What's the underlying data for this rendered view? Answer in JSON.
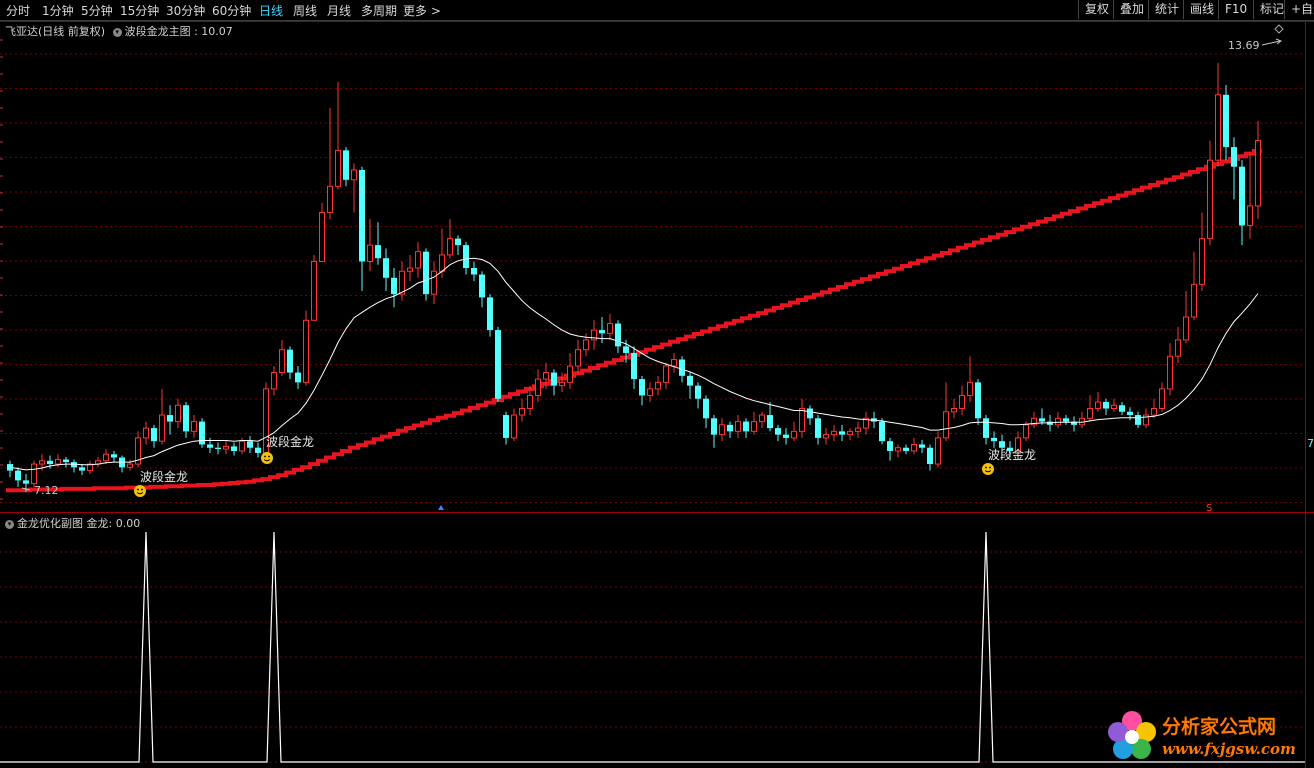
{
  "toolbar": {
    "periods": [
      "分时",
      "1分钟",
      "5分钟",
      "15分钟",
      "30分钟",
      "60分钟",
      "日线",
      "周线",
      "月线",
      "多周期",
      "更多 >"
    ],
    "active_period": "日线",
    "tools": [
      "复权",
      "叠加",
      "统计",
      "画线",
      "F10",
      "标记",
      "+自选"
    ]
  },
  "main_panel": {
    "stock_title": "飞亚达(日线 前复权)",
    "indicator_name": "波段金龙主图",
    "indicator_value": ": 10.07",
    "high_marker": "13.69",
    "low_marker": "7.12",
    "signal_label": "波段金龙",
    "right_edge_label": "7"
  },
  "sub_panel": {
    "indicator_name": "金龙优化副图",
    "series_label": "金龙:",
    "series_value": "0.00"
  },
  "watermark": {
    "title": "分析家公式网",
    "url": "www.fxjgsw.com"
  },
  "chart_data": {
    "type": "candlestick",
    "price_range": [
      7.0,
      14.1
    ],
    "price_high": 13.69,
    "price_low": 7.12,
    "colors": {
      "up": "#ff3333",
      "down": "#54ffff",
      "ma": "#ffffff",
      "band": "#e8141e",
      "grid": "#7a0000"
    },
    "candles": [
      [
        7.55,
        7.45,
        7.6,
        7.35
      ],
      [
        7.45,
        7.3,
        7.5,
        7.2
      ],
      [
        7.3,
        7.25,
        7.4,
        7.12
      ],
      [
        7.25,
        7.55,
        7.6,
        7.2
      ],
      [
        7.55,
        7.6,
        7.7,
        7.45
      ],
      [
        7.6,
        7.55,
        7.68,
        7.48
      ],
      [
        7.55,
        7.62,
        7.7,
        7.5
      ],
      [
        7.62,
        7.58,
        7.66,
        7.5
      ],
      [
        7.58,
        7.5,
        7.62,
        7.42
      ],
      [
        7.5,
        7.45,
        7.55,
        7.38
      ],
      [
        7.45,
        7.55,
        7.6,
        7.4
      ],
      [
        7.55,
        7.6,
        7.66,
        7.5
      ],
      [
        7.6,
        7.7,
        7.78,
        7.55
      ],
      [
        7.7,
        7.65,
        7.75,
        7.58
      ],
      [
        7.65,
        7.5,
        7.68,
        7.42
      ],
      [
        7.5,
        7.55,
        7.62,
        7.45
      ],
      [
        7.55,
        7.95,
        8.05,
        7.5
      ],
      [
        7.95,
        8.1,
        8.2,
        7.85
      ],
      [
        8.1,
        7.9,
        8.15,
        7.8
      ],
      [
        7.9,
        8.3,
        8.7,
        7.85
      ],
      [
        8.3,
        8.2,
        8.45,
        8.0
      ],
      [
        8.2,
        8.45,
        8.55,
        8.1
      ],
      [
        8.45,
        8.05,
        8.5,
        7.95
      ],
      [
        8.05,
        8.2,
        8.3,
        7.95
      ],
      [
        8.2,
        7.85,
        8.25,
        7.8
      ],
      [
        7.85,
        7.8,
        7.95,
        7.72
      ],
      [
        7.8,
        7.78,
        7.88,
        7.7
      ],
      [
        7.78,
        7.82,
        7.9,
        7.7
      ],
      [
        7.82,
        7.75,
        7.88,
        7.68
      ],
      [
        7.75,
        7.9,
        7.95,
        7.7
      ],
      [
        7.9,
        7.8,
        7.98,
        7.72
      ],
      [
        7.8,
        7.72,
        7.88,
        7.65
      ],
      [
        7.72,
        8.7,
        8.8,
        7.68
      ],
      [
        8.7,
        8.95,
        9.05,
        8.6
      ],
      [
        8.95,
        9.3,
        9.45,
        8.9
      ],
      [
        9.3,
        8.95,
        9.35,
        8.85
      ],
      [
        8.95,
        8.8,
        9.05,
        8.7
      ],
      [
        8.8,
        9.75,
        9.9,
        8.75
      ],
      [
        9.75,
        10.65,
        10.75,
        10.55
      ],
      [
        10.65,
        11.4,
        11.55,
        11.2
      ],
      [
        11.4,
        11.8,
        13.0,
        11.3
      ],
      [
        11.8,
        12.35,
        13.4,
        11.75
      ],
      [
        12.35,
        11.9,
        12.4,
        11.8
      ],
      [
        11.9,
        12.05,
        12.15,
        11.4
      ],
      [
        12.05,
        10.65,
        12.1,
        10.2
      ],
      [
        10.65,
        10.9,
        11.3,
        10.5
      ],
      [
        10.9,
        10.7,
        11.25,
        10.6
      ],
      [
        10.7,
        10.4,
        10.85,
        10.2
      ],
      [
        10.4,
        10.15,
        10.55,
        9.95
      ],
      [
        10.15,
        10.5,
        10.65,
        10.05
      ],
      [
        10.5,
        10.55,
        10.75,
        10.35
      ],
      [
        10.55,
        10.8,
        10.95,
        10.4
      ],
      [
        10.8,
        10.15,
        10.85,
        10.05
      ],
      [
        10.15,
        10.5,
        10.65,
        10.0
      ],
      [
        10.5,
        10.75,
        11.15,
        10.4
      ],
      [
        10.75,
        11.0,
        11.3,
        10.7
      ],
      [
        11.0,
        10.9,
        11.05,
        10.75
      ],
      [
        10.9,
        10.55,
        10.95,
        10.45
      ],
      [
        10.55,
        10.45,
        10.65,
        10.35
      ],
      [
        10.45,
        10.1,
        10.5,
        9.95
      ],
      [
        10.1,
        9.6,
        10.15,
        9.5
      ],
      [
        9.6,
        8.55,
        9.65,
        8.5
      ],
      [
        8.3,
        7.95,
        8.35,
        7.85
      ],
      [
        7.95,
        8.3,
        8.4,
        7.9
      ],
      [
        8.3,
        8.4,
        8.55,
        8.2
      ],
      [
        8.4,
        8.6,
        8.75,
        8.3
      ],
      [
        8.6,
        8.85,
        9.0,
        8.5
      ],
      [
        8.85,
        8.95,
        9.1,
        8.7
      ],
      [
        8.95,
        8.75,
        9.0,
        8.6
      ],
      [
        8.75,
        8.8,
        8.95,
        8.65
      ],
      [
        8.8,
        9.05,
        9.25,
        8.7
      ],
      [
        9.05,
        9.3,
        9.45,
        8.95
      ],
      [
        9.3,
        9.45,
        9.55,
        9.2
      ],
      [
        9.45,
        9.6,
        9.75,
        9.3
      ],
      [
        9.6,
        9.55,
        9.8,
        9.4
      ],
      [
        9.55,
        9.7,
        9.85,
        9.45
      ],
      [
        9.7,
        9.35,
        9.75,
        9.25
      ],
      [
        9.35,
        9.25,
        9.45,
        9.1
      ],
      [
        9.25,
        8.85,
        9.35,
        8.7
      ],
      [
        8.85,
        8.6,
        8.9,
        8.45
      ],
      [
        8.6,
        8.7,
        8.8,
        8.5
      ],
      [
        8.7,
        8.8,
        8.9,
        8.6
      ],
      [
        8.8,
        9.05,
        9.1,
        8.7
      ],
      [
        9.05,
        9.15,
        9.25,
        8.95
      ],
      [
        9.15,
        8.9,
        9.2,
        8.8
      ],
      [
        8.9,
        8.75,
        8.95,
        8.55
      ],
      [
        8.75,
        8.55,
        8.8,
        8.4
      ],
      [
        8.55,
        8.25,
        8.6,
        8.1
      ],
      [
        8.25,
        8.0,
        8.3,
        7.8
      ],
      [
        8.0,
        8.15,
        8.25,
        7.9
      ],
      [
        8.15,
        8.05,
        8.2,
        7.95
      ],
      [
        8.05,
        8.2,
        8.3,
        7.95
      ],
      [
        8.2,
        8.05,
        8.25,
        7.95
      ],
      [
        8.05,
        8.2,
        8.35,
        8.0
      ],
      [
        8.2,
        8.3,
        8.35,
        8.1
      ],
      [
        8.3,
        8.1,
        8.5,
        8.05
      ],
      [
        8.1,
        8.0,
        8.15,
        7.9
      ],
      [
        8.0,
        7.95,
        8.1,
        7.85
      ],
      [
        7.95,
        8.05,
        8.2,
        7.9
      ],
      [
        8.05,
        8.4,
        8.55,
        7.95
      ],
      [
        8.4,
        8.25,
        8.45,
        8.15
      ],
      [
        8.25,
        7.95,
        8.3,
        7.85
      ],
      [
        7.95,
        8.0,
        8.1,
        7.85
      ],
      [
        8.0,
        8.05,
        8.15,
        7.9
      ],
      [
        8.05,
        8.0,
        8.15,
        7.9
      ],
      [
        8.0,
        8.05,
        8.1,
        7.92
      ],
      [
        8.05,
        8.1,
        8.2,
        7.95
      ],
      [
        8.1,
        8.25,
        8.35,
        8.0
      ],
      [
        8.25,
        8.2,
        8.35,
        8.1
      ],
      [
        8.2,
        7.9,
        8.25,
        7.85
      ],
      [
        7.9,
        7.75,
        7.95,
        7.6
      ],
      [
        7.75,
        7.8,
        7.85,
        7.65
      ],
      [
        7.8,
        7.75,
        7.85,
        7.7
      ],
      [
        7.75,
        7.85,
        7.95,
        7.7
      ],
      [
        7.85,
        7.8,
        7.92,
        7.72
      ],
      [
        7.8,
        7.55,
        7.85,
        7.45
      ],
      [
        7.55,
        7.95,
        8.05,
        7.5
      ],
      [
        7.95,
        8.35,
        8.8,
        7.9
      ],
      [
        8.35,
        8.4,
        8.55,
        8.25
      ],
      [
        8.4,
        8.6,
        8.75,
        8.3
      ],
      [
        8.6,
        8.8,
        9.2,
        8.5
      ],
      [
        8.8,
        8.25,
        8.85,
        8.15
      ],
      [
        8.25,
        7.95,
        8.3,
        7.85
      ],
      [
        7.95,
        7.9,
        8.05,
        7.8
      ],
      [
        7.9,
        7.8,
        8.0,
        7.75
      ],
      [
        7.8,
        7.75,
        7.9,
        7.65
      ],
      [
        7.75,
        7.95,
        8.05,
        7.7
      ],
      [
        7.95,
        8.15,
        8.2,
        7.9
      ],
      [
        8.15,
        8.25,
        8.35,
        8.1
      ],
      [
        8.25,
        8.2,
        8.4,
        8.15
      ],
      [
        8.2,
        8.15,
        8.3,
        8.05
      ],
      [
        8.15,
        8.25,
        8.35,
        8.1
      ],
      [
        8.25,
        8.2,
        8.3,
        8.15
      ],
      [
        8.2,
        8.15,
        8.28,
        8.05
      ],
      [
        8.15,
        8.25,
        8.35,
        8.1
      ],
      [
        8.25,
        8.4,
        8.6,
        8.2
      ],
      [
        8.4,
        8.5,
        8.65,
        8.35
      ],
      [
        8.5,
        8.4,
        8.55,
        8.3
      ],
      [
        8.4,
        8.45,
        8.55,
        8.35
      ],
      [
        8.45,
        8.35,
        8.5,
        8.3
      ],
      [
        8.35,
        8.3,
        8.42,
        8.22
      ],
      [
        8.3,
        8.15,
        8.35,
        8.1
      ],
      [
        8.15,
        8.3,
        8.4,
        8.1
      ],
      [
        8.3,
        8.4,
        8.55,
        8.25
      ],
      [
        8.4,
        8.7,
        8.8,
        8.35
      ],
      [
        8.7,
        9.2,
        9.4,
        8.6
      ],
      [
        9.2,
        9.45,
        9.65,
        9.1
      ],
      [
        9.45,
        9.8,
        10.2,
        9.4
      ],
      [
        9.8,
        10.3,
        10.8,
        9.75
      ],
      [
        10.3,
        11.0,
        11.4,
        10.2
      ],
      [
        11.0,
        12.2,
        12.5,
        10.9
      ],
      [
        12.2,
        13.2,
        13.69,
        12.1
      ],
      [
        13.2,
        12.4,
        13.35,
        12.2
      ],
      [
        12.4,
        12.1,
        12.55,
        11.6
      ],
      [
        12.1,
        11.2,
        12.2,
        10.9
      ],
      [
        11.2,
        11.5,
        12.3,
        11.0
      ],
      [
        11.5,
        12.5,
        12.8,
        11.3
      ]
    ],
    "ma_line": [
      7.5,
      7.48,
      7.46,
      7.47,
      7.49,
      7.52,
      7.54,
      7.55,
      7.55,
      7.54,
      7.54,
      7.55,
      7.57,
      7.58,
      7.58,
      7.58,
      7.61,
      7.65,
      7.68,
      7.74,
      7.79,
      7.84,
      7.87,
      7.9,
      7.91,
      7.91,
      7.91,
      7.91,
      7.9,
      7.91,
      7.91,
      7.9,
      7.96,
      8.03,
      8.14,
      8.24,
      8.33,
      8.48,
      8.68,
      8.91,
      9.15,
      9.41,
      9.62,
      9.79,
      9.87,
      9.95,
      10.02,
      10.08,
      10.12,
      10.18,
      10.24,
      10.32,
      10.36,
      10.41,
      10.5,
      10.6,
      10.66,
      10.69,
      10.7,
      10.68,
      10.62,
      10.5,
      10.33,
      10.19,
      10.05,
      9.94,
      9.85,
      9.77,
      9.68,
      9.6,
      9.54,
      9.51,
      9.49,
      9.48,
      9.47,
      9.47,
      9.43,
      9.39,
      9.32,
      9.24,
      9.17,
      9.12,
      9.08,
      9.04,
      9.0,
      8.96,
      8.91,
      8.85,
      8.78,
      8.72,
      8.66,
      8.61,
      8.56,
      8.52,
      8.49,
      8.46,
      8.43,
      8.4,
      8.37,
      8.37,
      8.35,
      8.33,
      8.31,
      8.29,
      8.27,
      8.26,
      8.24,
      8.23,
      8.22,
      8.21,
      8.19,
      8.17,
      8.15,
      8.13,
      8.11,
      8.07,
      8.07,
      8.09,
      8.11,
      8.14,
      8.18,
      8.19,
      8.19,
      8.18,
      8.17,
      8.15,
      8.15,
      8.16,
      8.17,
      8.18,
      8.18,
      8.19,
      8.19,
      8.19,
      8.19,
      8.21,
      8.23,
      8.24,
      8.25,
      8.26,
      8.26,
      8.26,
      8.27,
      8.28,
      8.31,
      8.37,
      8.45,
      8.56,
      8.69,
      8.85,
      9.07,
      9.33,
      9.55,
      9.73,
      9.86,
      10.0,
      10.16
    ],
    "band_line": [
      7.15,
      7.15,
      7.15,
      7.16,
      7.16,
      7.16,
      7.16,
      7.17,
      7.17,
      7.17,
      7.17,
      7.18,
      7.18,
      7.18,
      7.18,
      7.19,
      7.19,
      7.19,
      7.2,
      7.2,
      7.21,
      7.21,
      7.22,
      7.22,
      7.23,
      7.23,
      7.24,
      7.25,
      7.26,
      7.27,
      7.28,
      7.3,
      7.32,
      7.35,
      7.38,
      7.42,
      7.46,
      7.5,
      7.55,
      7.6,
      7.65,
      7.7,
      7.75,
      7.8,
      7.84,
      7.88,
      7.93,
      7.97,
      8.01,
      8.06,
      8.1,
      8.14,
      8.18,
      8.22,
      8.26,
      8.29,
      8.33,
      8.37,
      8.41,
      8.45,
      8.49,
      8.53,
      8.58,
      8.62,
      8.66,
      8.7,
      8.74,
      8.78,
      8.82,
      8.86,
      8.9,
      8.94,
      8.98,
      9.02,
      9.06,
      9.1,
      9.14,
      9.18,
      9.22,
      9.26,
      9.3,
      9.34,
      9.38,
      9.42,
      9.46,
      9.5,
      9.54,
      9.58,
      9.62,
      9.66,
      9.7,
      9.74,
      9.78,
      9.82,
      9.86,
      9.9,
      9.94,
      9.98,
      10.02,
      10.06,
      10.1,
      10.14,
      10.18,
      10.22,
      10.26,
      10.3,
      10.34,
      10.38,
      10.42,
      10.46,
      10.5,
      10.54,
      10.58,
      10.62,
      10.66,
      10.7,
      10.74,
      10.78,
      10.82,
      10.86,
      10.9,
      10.94,
      10.98,
      11.02,
      11.06,
      11.1,
      11.14,
      11.18,
      11.22,
      11.26,
      11.3,
      11.34,
      11.38,
      11.42,
      11.46,
      11.5,
      11.54,
      11.58,
      11.62,
      11.66,
      11.7,
      11.74,
      11.78,
      11.82,
      11.86,
      11.9,
      11.94,
      11.98,
      12.02,
      12.06,
      12.1,
      12.14,
      12.18,
      12.22,
      12.26,
      12.3,
      12.34
    ],
    "signal_bars": [
      16,
      32,
      120
    ],
    "sub_spikes": [
      17,
      33,
      122
    ],
    "sub_value": 0.0
  }
}
